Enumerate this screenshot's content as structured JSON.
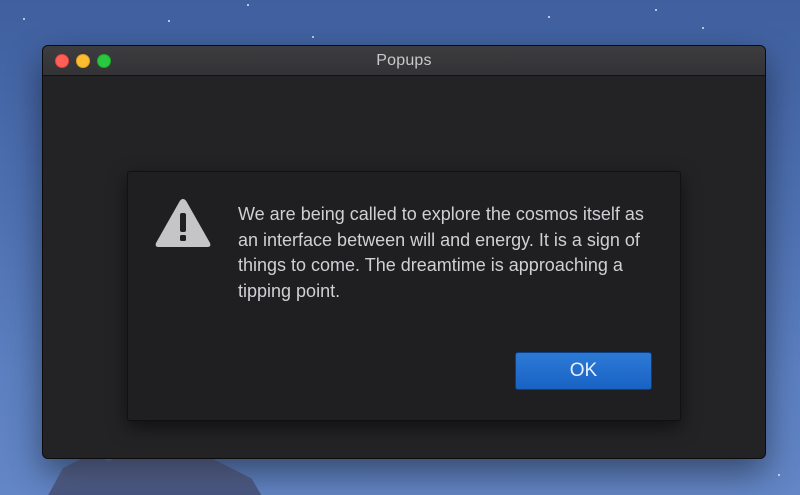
{
  "window": {
    "title": "Popups"
  },
  "dialog": {
    "icon": "warning-icon",
    "message": "We are being called to explore the cosmos itself as an interface between will and energy. It is a sign of things to come. The dreamtime is approaching a tipping point.",
    "ok_label": "OK"
  },
  "colors": {
    "accent": "#1862c4",
    "close": "#fe5f57",
    "minimize": "#febc2e",
    "zoom": "#28c840"
  }
}
